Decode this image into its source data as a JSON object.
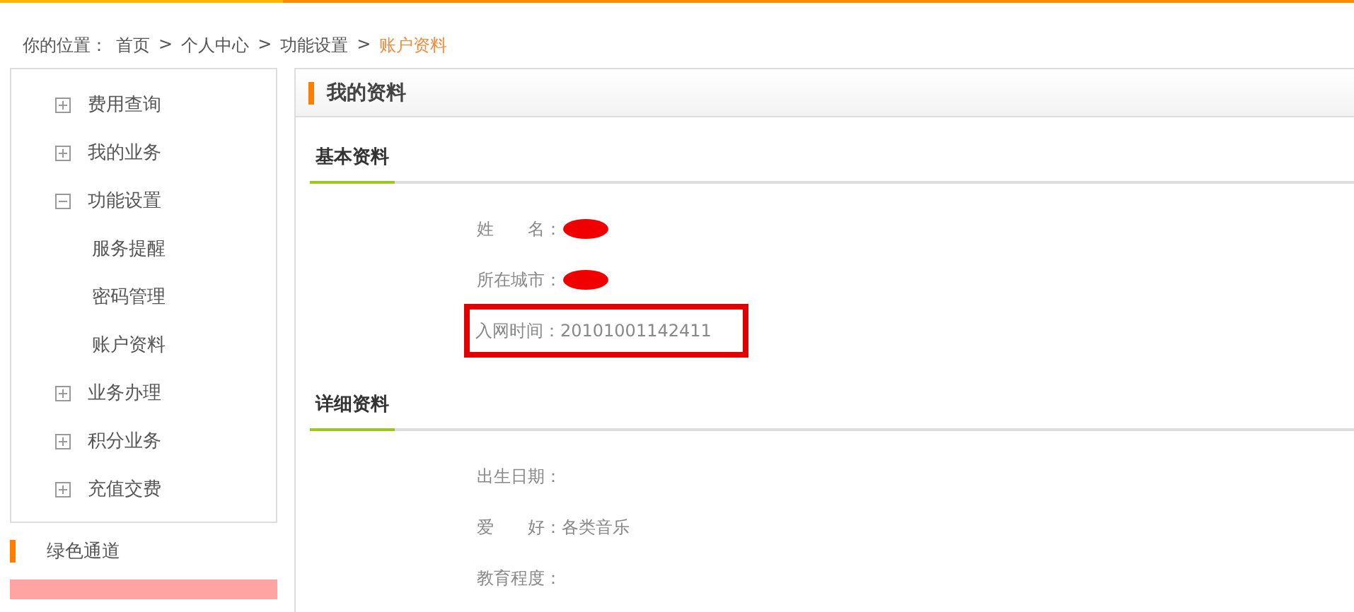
{
  "breadcrumb": {
    "label": "你的位置：",
    "items": [
      {
        "text": "首页",
        "current": false
      },
      {
        "text": "个人中心",
        "current": false
      },
      {
        "text": "功能设置",
        "current": false
      },
      {
        "text": "账户资料",
        "current": true
      }
    ],
    "separator": ">"
  },
  "sidebar": {
    "items": [
      {
        "label": "费用查询",
        "expanded": false
      },
      {
        "label": "我的业务",
        "expanded": false
      },
      {
        "label": "功能设置",
        "expanded": true,
        "children": [
          {
            "label": "服务提醒"
          },
          {
            "label": "密码管理"
          },
          {
            "label": "账户资料"
          }
        ]
      },
      {
        "label": "业务办理",
        "expanded": false
      },
      {
        "label": "积分业务",
        "expanded": false
      },
      {
        "label": "充值交费",
        "expanded": false
      }
    ],
    "green_channel": "绿色通道"
  },
  "panel": {
    "title": "我的资料",
    "sections": [
      {
        "title": "基本资料",
        "fields": [
          {
            "label": "姓　　名：",
            "redacted": true,
            "highlighted": false
          },
          {
            "label": "所在城市：",
            "redacted": true,
            "highlighted": false
          },
          {
            "label": "入网时间：",
            "value": "20101001142411",
            "redacted": false,
            "highlighted": true
          }
        ]
      },
      {
        "title": "详细资料",
        "fields": [
          {
            "label": "出生日期：",
            "redacted": false,
            "highlighted": false
          },
          {
            "label": "爱　　好：",
            "value": "各类音乐",
            "redacted": false,
            "highlighted": false
          },
          {
            "label": "教育程度：",
            "redacted": false,
            "highlighted": false
          }
        ]
      }
    ]
  }
}
